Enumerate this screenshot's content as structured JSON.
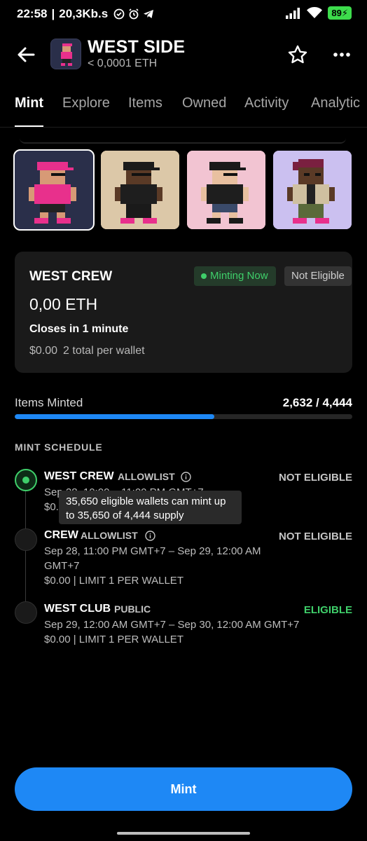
{
  "status_bar": {
    "time": "22:58",
    "speed": "20,3Kb.s",
    "battery": "89"
  },
  "header": {
    "title": "WEST SIDE",
    "price": "< 0,0001 ETH"
  },
  "tabs": [
    {
      "label": "Mint",
      "active": true
    },
    {
      "label": "Explore"
    },
    {
      "label": "Items"
    },
    {
      "label": "Owned"
    },
    {
      "label": "Activity"
    },
    {
      "label": "Analytic"
    }
  ],
  "card": {
    "title": "WEST CREW",
    "badge_minting": "Minting Now",
    "badge_eligibility": "Not Eligible",
    "price": "0,00 ETH",
    "closes": "Closes in 1 minute",
    "meta_price": "$0.00",
    "meta_limit": "2 total per wallet"
  },
  "minted": {
    "label": "Items Minted",
    "value": "2,632 / 4,444",
    "progress": 0.592
  },
  "schedule": {
    "title": "MINT SCHEDULE",
    "phases": [
      {
        "name": "WEST CREW",
        "type": "ALLOWLIST",
        "status": "NOT ELIGIBLE",
        "line1_partial": "Sep 28, 10:00 – 11:00 PM GMT+7",
        "line2_partial": "$0.",
        "active": true
      },
      {
        "name": "CREW",
        "type": "ALLOWLIST",
        "status": "NOT ELIGIBLE",
        "line1": "Sep 28, 11:00 PM GMT+7 – Sep 29, 12:00 AM",
        "line2": "GMT+7",
        "line3": "$0.00 | LIMIT 1 PER WALLET"
      },
      {
        "name": "WEST CLUB",
        "type": "PUBLIC",
        "status": "ELIGIBLE",
        "line1": "Sep 29, 12:00 AM GMT+7 – Sep 30, 12:00 AM GMT+7",
        "line2": "$0.00 | LIMIT 1 PER WALLET"
      }
    ]
  },
  "tooltip": {
    "line1": "35,650 eligible wallets can mint up",
    "line2": "to 35,650 of 4,444 supply"
  },
  "mint_button": "Mint",
  "colors": {
    "accent": "#1e88f5",
    "success": "#3fcf6a",
    "card_bg": "#1a1a1a"
  },
  "icons": [
    "back-arrow-icon",
    "star-icon",
    "more-icon",
    "info-icon",
    "wifi-icon",
    "signal-icon",
    "telegram-icon",
    "alarm-icon"
  ]
}
